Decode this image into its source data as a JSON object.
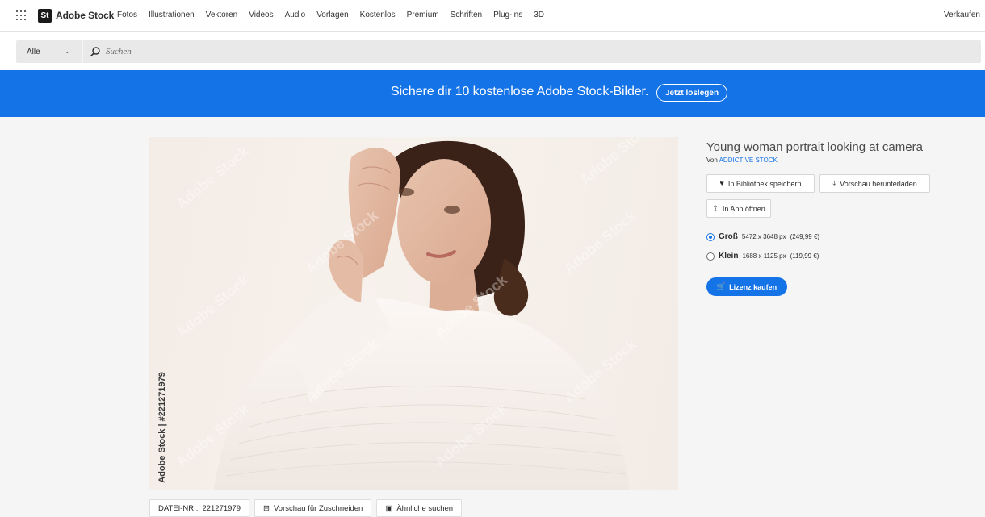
{
  "header": {
    "apps_icon": "apps-grid-icon",
    "logo_badge": "St",
    "brand": "Adobe Stock",
    "nav": [
      "Fotos",
      "Illustrationen",
      "Vektoren",
      "Videos",
      "Audio",
      "Vorlagen",
      "Kostenlos",
      "Premium",
      "Schriften",
      "Plug-ins",
      "3D"
    ],
    "right_link": "Verkaufen"
  },
  "search": {
    "scope": "Alle",
    "scope_icon": "chevron-down-icon",
    "icon": "search-icon",
    "placeholder": "Suchen"
  },
  "banner": {
    "text": "Sichere dir 10 kostenlose Adobe Stock-Bilder.",
    "button": "Jetzt loslegen",
    "color": "#1473e6"
  },
  "image": {
    "watermark_text": "Adobe Stock",
    "side_watermark": "Adobe Stock | #221271979"
  },
  "image_bar": {
    "file_label": "DATEI-NR.:",
    "file_number": "221271979",
    "crop_button": "Vorschau für Zuschneiden",
    "crop_icon": "crop-icon",
    "similar_button": "Ähnliche suchen",
    "similar_icon": "camera-icon"
  },
  "details": {
    "title": "Young woman portrait looking at camera",
    "author_prefix": "Von",
    "author": "ADDICTIVE STOCK",
    "save_button": "In Bibliothek speichern",
    "save_icon": "heart-icon",
    "download_button": "Vorschau herunterladen",
    "download_icon": "download-icon",
    "open_button": "In App öffnen",
    "open_icon": "share-icon",
    "sizes": [
      {
        "name": "Groß",
        "dims": "5472 x 3648 px",
        "price": "(249,99 €)",
        "selected": true
      },
      {
        "name": "Klein",
        "dims": "1688 x 1125 px",
        "price": "(119,99 €)",
        "selected": false
      }
    ],
    "buy_button": "Lizenz kaufen",
    "buy_icon": "cart-icon",
    "accent": "#1473e6"
  }
}
